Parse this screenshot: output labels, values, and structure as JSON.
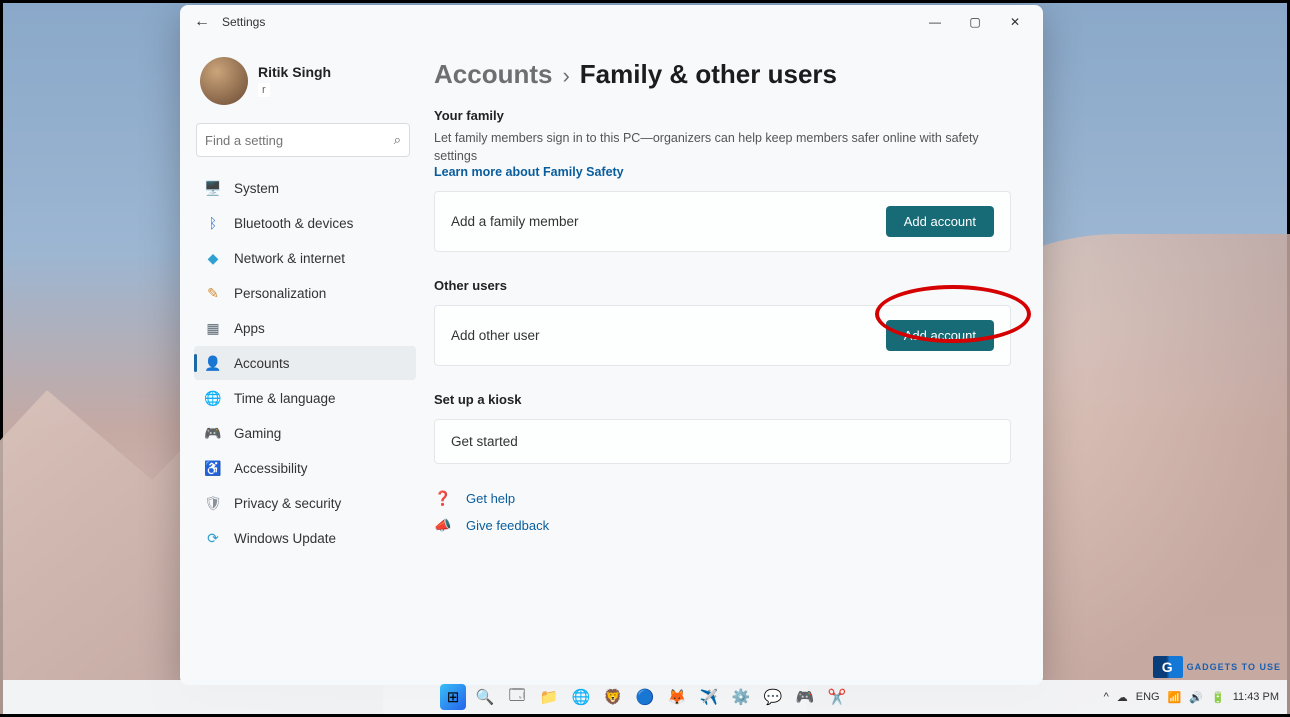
{
  "window": {
    "title": "Settings"
  },
  "profile": {
    "name": "Ritik Singh",
    "email": "r"
  },
  "search": {
    "placeholder": "Find a setting"
  },
  "nav": {
    "items": [
      {
        "label": "System",
        "icon": "🖥️",
        "color": "#2e7ad1"
      },
      {
        "label": "Bluetooth & devices",
        "icon": "ᛒ",
        "color": "#2e7ad1"
      },
      {
        "label": "Network & internet",
        "icon": "◆",
        "color": "#2ea0d1"
      },
      {
        "label": "Personalization",
        "icon": "✎",
        "color": "#d18b2e"
      },
      {
        "label": "Apps",
        "icon": "▦",
        "color": "#5e6a76"
      },
      {
        "label": "Accounts",
        "icon": "👤",
        "color": "#2e9e6b"
      },
      {
        "label": "Time & language",
        "icon": "🌐",
        "color": "#2e9ed1"
      },
      {
        "label": "Gaming",
        "icon": "🎮",
        "color": "#5e6a76"
      },
      {
        "label": "Accessibility",
        "icon": "♿",
        "color": "#3a6ea5"
      },
      {
        "label": "Privacy & security",
        "icon": "🛡",
        "color": "#8a9199"
      },
      {
        "label": "Windows Update",
        "icon": "⟳",
        "color": "#2e9ed1"
      }
    ],
    "activeIndex": 5
  },
  "breadcrumb": {
    "parent": "Accounts",
    "current": "Family & other users"
  },
  "sections": {
    "family": {
      "heading": "Your family",
      "desc": "Let family members sign in to this PC—organizers can help keep members safer online with safety settings",
      "link": "Learn more about Family Safety",
      "card_label": "Add a family member",
      "button": "Add account"
    },
    "other": {
      "heading": "Other users",
      "card_label": "Add other user",
      "button": "Add account"
    },
    "kiosk": {
      "heading": "Set up a kiosk",
      "card_label": "Get started"
    }
  },
  "help": {
    "get_help": "Get help",
    "feedback": "Give feedback"
  },
  "taskbar": {
    "lang": "ENG",
    "time": "11:43 PM"
  },
  "watermark": "GADGETS TO USE"
}
